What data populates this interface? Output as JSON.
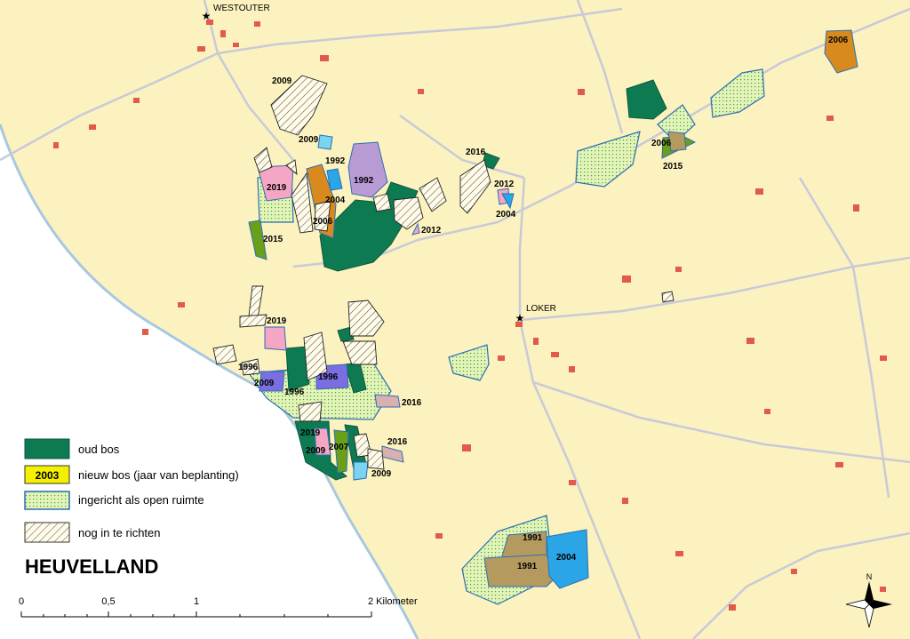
{
  "map": {
    "title": "HEUVELLAND",
    "towns": {
      "westouter": "WESTOUTER",
      "loker": "LOKER"
    },
    "legend": {
      "oud_bos": "oud bos",
      "nieuw_bos_sample": "2003",
      "nieuw_bos": "nieuw bos (jaar van beplanting)",
      "open_ruimte": "ingericht als open ruimte",
      "nog_in_te_richten": "nog in te richten"
    },
    "scale": {
      "t0": "0",
      "t05": "0,5",
      "t1": "1",
      "t2": "2 Kilometer"
    },
    "north": "N",
    "parcel_years": {
      "y2006_ne": "2006",
      "y2009_top": "2009",
      "y2009_b": "2009",
      "y1992_a": "1992",
      "y1992_b": "1992",
      "y2019_a": "2019",
      "y2004_a": "2004",
      "y2006_a": "2006",
      "y2015_w": "2015",
      "y2016_a": "2016",
      "y2012_a": "2012",
      "y2004_b": "2004",
      "y2012_b": "2012",
      "y2006_e": "2006",
      "y2015_e": "2015",
      "y2019_b": "2019",
      "y1996_a": "1996",
      "y2009_c": "2009",
      "y1996_b": "1996",
      "y1996_c": "1996",
      "y2016_b": "2016",
      "y2019_c": "2019",
      "y2007": "2007",
      "y2009_d": "2009",
      "y2016_c": "2016",
      "y2009_e": "2009",
      "y1991_a": "1991",
      "y1991_b": "1991",
      "y2004_c": "2004"
    },
    "colors": {
      "background": "#fbf2bf",
      "sea": "#ffffff",
      "oud_bos": "#0e7a52",
      "open_ruimte": "#e3f4b8",
      "nieuw_bos_sample": "#f5f000",
      "pink": "#f4a6c4",
      "lilac": "#b89ad4",
      "orange": "#d98a1e",
      "tan": "#b59a60",
      "cyan": "#7ad4f0",
      "blue": "#2aa6e6",
      "violet": "#7a6ee0",
      "olive": "#6aa019",
      "rose": "#d9b0b0",
      "road": "#c9c9d9",
      "building": "#e25a4a"
    }
  }
}
